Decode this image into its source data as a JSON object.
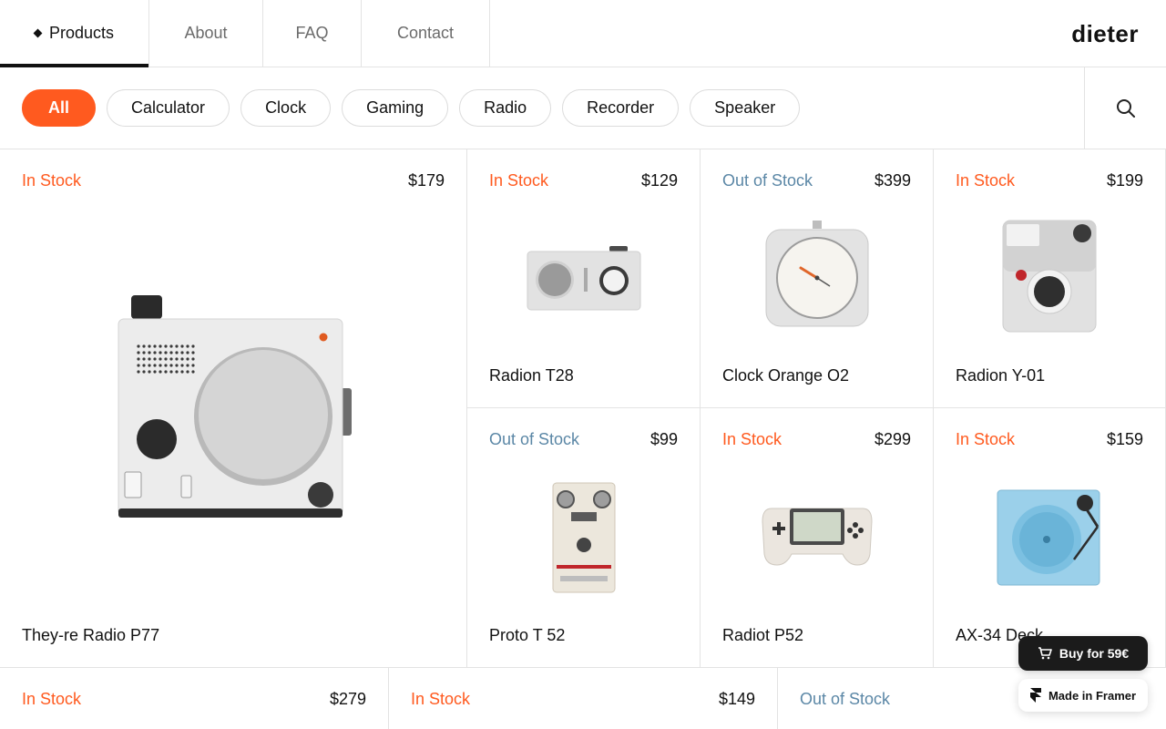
{
  "nav": {
    "tabs": [
      {
        "label": "Products"
      },
      {
        "label": "About"
      },
      {
        "label": "FAQ"
      },
      {
        "label": "Contact"
      }
    ],
    "logo": "dieter"
  },
  "filters": {
    "chips": [
      {
        "label": "All"
      },
      {
        "label": "Calculator"
      },
      {
        "label": "Clock"
      },
      {
        "label": "Gaming"
      },
      {
        "label": "Radio"
      },
      {
        "label": "Recorder"
      },
      {
        "label": "Speaker"
      }
    ],
    "search_icon": "search-icon"
  },
  "products": [
    {
      "stock": "In Stock",
      "price": "$179",
      "name": "They-re Radio P77"
    },
    {
      "stock": "In Stock",
      "price": "$129",
      "name": "Radion T28"
    },
    {
      "stock": "Out of Stock",
      "price": "$399",
      "name": "Clock Orange O2"
    },
    {
      "stock": "In Stock",
      "price": "$199",
      "name": "Radion Y-01"
    },
    {
      "stock": "Out of Stock",
      "price": "$99",
      "name": "Proto T 52"
    },
    {
      "stock": "In Stock",
      "price": "$299",
      "name": "Radiot P52"
    },
    {
      "stock": "In Stock",
      "price": "$159",
      "name": "AX-34 Deck"
    },
    {
      "stock": "In Stock",
      "price": "$279",
      "name": ""
    },
    {
      "stock": "In Stock",
      "price": "$149",
      "name": ""
    },
    {
      "stock": "Out of Stock",
      "price": "",
      "name": ""
    }
  ],
  "buy_button": {
    "label": "Buy for 59€",
    "icon": "cart-icon"
  },
  "framer_badge": {
    "label": "Made in Framer",
    "icon": "framer-icon"
  },
  "colors": {
    "accent": "#ff5a1f",
    "out_of_stock": "#5b87a6",
    "text": "#111111",
    "border": "#e3e3e3"
  }
}
